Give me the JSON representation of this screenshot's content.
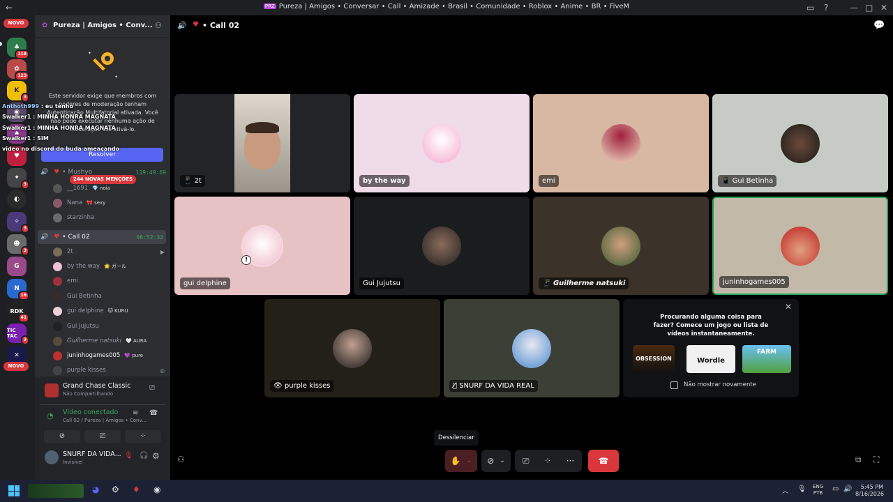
{
  "window": {
    "title": "Pureza | Amigos • Conversar • Call • Amizade • Brasil • Comunidade • Roblox • Anime • BR • FiveM",
    "logo_text": "PRZ"
  },
  "rail": {
    "novo_top": "NOVO",
    "novo_bottom": "NOVO",
    "badges": [
      "118",
      "123",
      "3",
      "3",
      "3",
      "3",
      "3",
      "3",
      "16",
      "41",
      "3"
    ],
    "labels": [
      "RDK",
      "TIC TAC"
    ]
  },
  "sidebar": {
    "server_name": "Pureza | Amigos • Conv...",
    "mfa_text": "Este servidor exige que membros com poderes de moderação tenham Autenticação Multifatorial ativada. Você não pode executar nenhuma ação de moderação até ativá-lo.",
    "resolve_label": "Resolver",
    "mentions_badge": "244 NOVAS MENÇÕES",
    "channel1": {
      "name": "• Mushyo",
      "timer": "119:49:69"
    },
    "channel1_users": [
      {
        "name": "__1691",
        "tag": "💎 noia"
      },
      {
        "name": "Nana",
        "tag": "🎀 sexy"
      },
      {
        "name": "starzinha",
        "tag": ""
      }
    ],
    "channel2": {
      "name": "• Call 02",
      "timer": "96:52:32"
    },
    "channel2_users": [
      {
        "name": "2t",
        "tag": ""
      },
      {
        "name": "by the way",
        "tag": "🌟 ガール"
      },
      {
        "name": "emi",
        "tag": ""
      },
      {
        "name": "Gui Betinha",
        "tag": ""
      },
      {
        "name": "gui delphine",
        "tag": "🐱 KURU"
      },
      {
        "name": "Gui Jujutsu",
        "tag": ""
      },
      {
        "name": "Guilherme natsuki",
        "tag": "🤍 AURA"
      },
      {
        "name": "juninhogames005",
        "tag": "💜 pure"
      },
      {
        "name": "purple kisses",
        "tag": ""
      }
    ],
    "activity": {
      "title": "Grand Chase Classic",
      "subtitle": "Não Compartilhando"
    },
    "voice": {
      "status": "Vídeo conectado",
      "location": "Call 02 / Pureza | Amigos • Conv..."
    },
    "user": {
      "name": "SNURF DA VIDA...",
      "status": "Invisível"
    }
  },
  "chat_overlay": [
    {
      "user": "Anthoth999",
      "msg": ": eu tenho"
    },
    {
      "user": "Swalker1",
      "msg": ": MINHA HONRA MAGNATA"
    },
    {
      "user": "Swalker1",
      "msg": ": MINHA HONRA MAGNATA"
    },
    {
      "user": "Swalker1",
      "msg": ": SIM"
    },
    {
      "user": "",
      "msg": "video no discord do buda ameaçando"
    }
  ],
  "main": {
    "channel_title": "• Call 02",
    "tiles": [
      {
        "name": "2t",
        "bg": "#232428"
      },
      {
        "name": "by the way",
        "bg": "#f0dce8"
      },
      {
        "name": "emi",
        "bg": "#d8b8a2"
      },
      {
        "name": "Gui Betinha",
        "bg": "#c7cbc6"
      },
      {
        "name": "gui delphine",
        "bg": "#e6c2c4"
      },
      {
        "name": "Gui Jujutsu",
        "bg": "#1b1c1e"
      },
      {
        "name": "Guilherme natsuki",
        "bg": "#3b3229"
      },
      {
        "name": "juninhogames005",
        "bg": "#c2b9a8"
      },
      {
        "name": "purple kisses",
        "bg": "#232017"
      },
      {
        "name": "SNURF DA VIDA REAL",
        "bg": "#3c3f35"
      }
    ],
    "activity_panel": {
      "prompt": "Procurando alguma coisa para fazer? Comece um jogo ou lista de vídeos instantaneamente.",
      "games": [
        "OBSESSION",
        "Wordle",
        "FARM"
      ],
      "dont_show": "Não mostrar novamente"
    },
    "tooltip": "Dessilenciar"
  },
  "taskbar": {
    "lang1": "ENG",
    "lang2": "PTB",
    "time": "5:45 PM",
    "date": "8/16/2026"
  }
}
